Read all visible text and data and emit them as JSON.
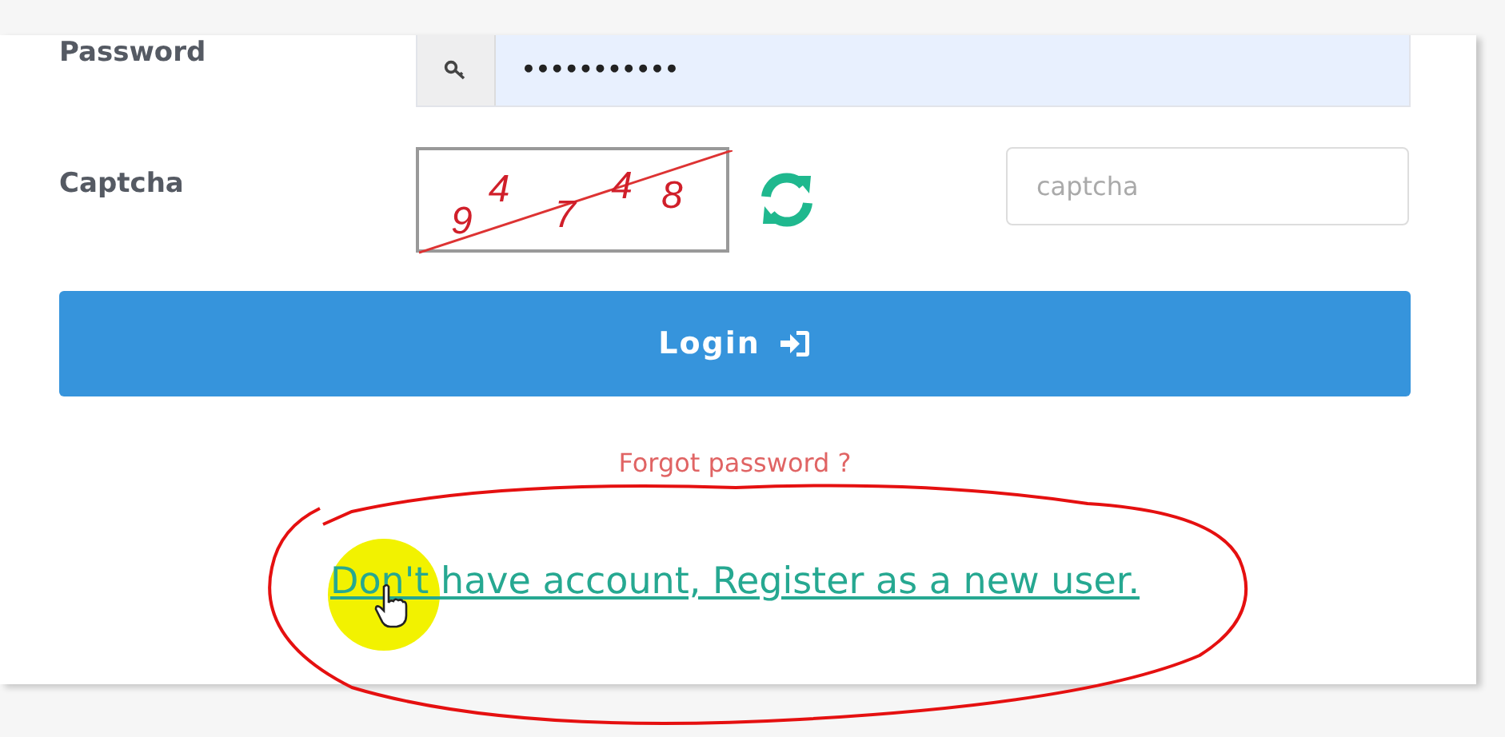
{
  "form": {
    "password": {
      "label": "Password",
      "value": "•••••••••••"
    },
    "captcha": {
      "label": "Captcha",
      "characters": [
        "9",
        "4",
        "7",
        "4",
        "8"
      ],
      "placeholder": "captcha"
    },
    "login_button": "Login",
    "forgot_link": "Forgot password ?",
    "register_link": "Don't have account, Register as a new user."
  }
}
